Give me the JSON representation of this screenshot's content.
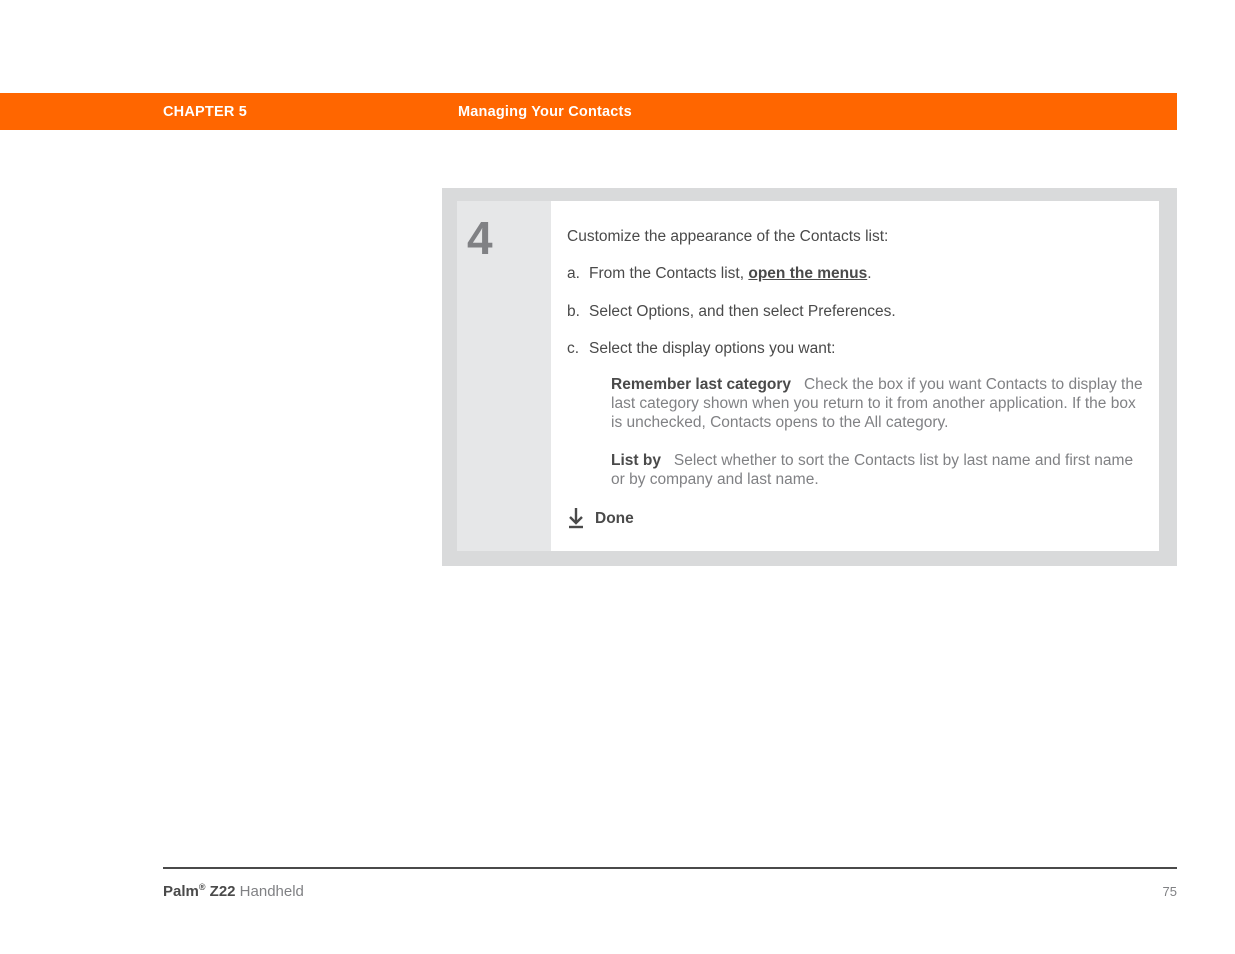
{
  "header": {
    "chapter": "CHAPTER 5",
    "title": "Managing Your Contacts"
  },
  "step": {
    "number": "4",
    "intro": "Customize the appearance of the Contacts list:",
    "items": [
      {
        "marker": "a.",
        "pre": "From the Contacts list, ",
        "link": "open the menus",
        "post": "."
      },
      {
        "marker": "b.",
        "text": "Select Options, and then select Preferences."
      },
      {
        "marker": "c.",
        "text": "Select the display options you want:",
        "sub": [
          {
            "lead": "Remember last category",
            "body": "Check the box if you want Contacts to display the last category shown when you return to it from another application. If the box is unchecked, Contacts opens to the All category."
          },
          {
            "lead": "List by",
            "body": "Select whether to sort the Contacts list by last name and first name or by company and last name."
          }
        ]
      }
    ],
    "done": "Done"
  },
  "footer": {
    "brand": "Palm",
    "reg": "®",
    "model": " Z22",
    "product": " Handheld",
    "page": "75"
  }
}
